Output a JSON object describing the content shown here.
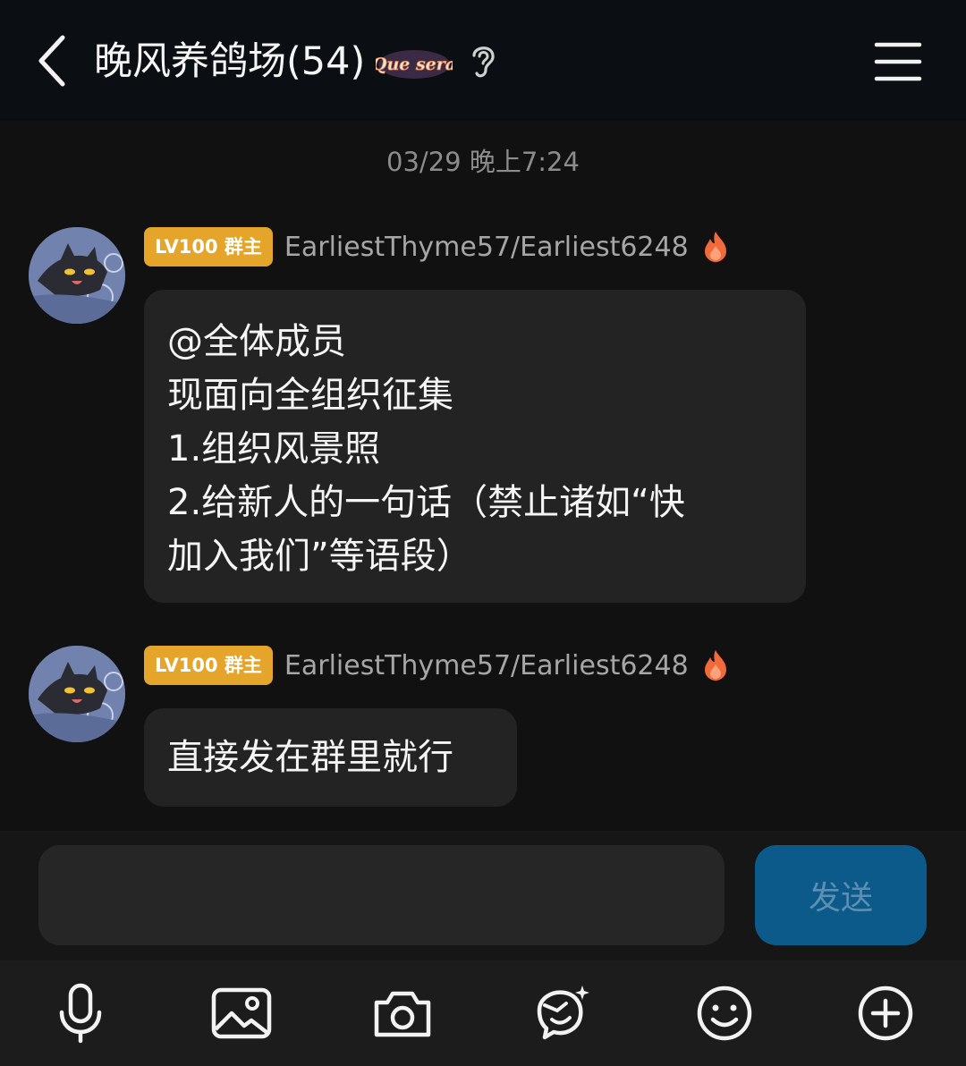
{
  "header": {
    "title": "晚风养鸽场(54)",
    "logo_text": "Que sera"
  },
  "timestamp": "03/29 晚上7:24",
  "messages": [
    {
      "badge": "LV100 群主",
      "username": "EarliestThyme57/Earliest6248",
      "lines": [
        "@全体成员",
        "现面向全组织征集",
        "1.组织风景照",
        "2.给新人的一句话（禁止诸如“快",
        "加入我们”等语段）"
      ]
    },
    {
      "badge": "LV100 群主",
      "username": "EarliestThyme57/Earliest6248",
      "lines": [
        "直接发在群里就行"
      ]
    }
  ],
  "composer": {
    "input_value": "",
    "send_label": "发送"
  },
  "toolbar": {
    "icons": [
      "microphone-icon",
      "image-icon",
      "camera-icon",
      "sticker-icon",
      "emoji-icon",
      "plus-icon"
    ]
  },
  "colors": {
    "badge": "#e5a42a",
    "send_button": "#0c5a8a",
    "bubble": "#232323",
    "background": "#111111"
  }
}
